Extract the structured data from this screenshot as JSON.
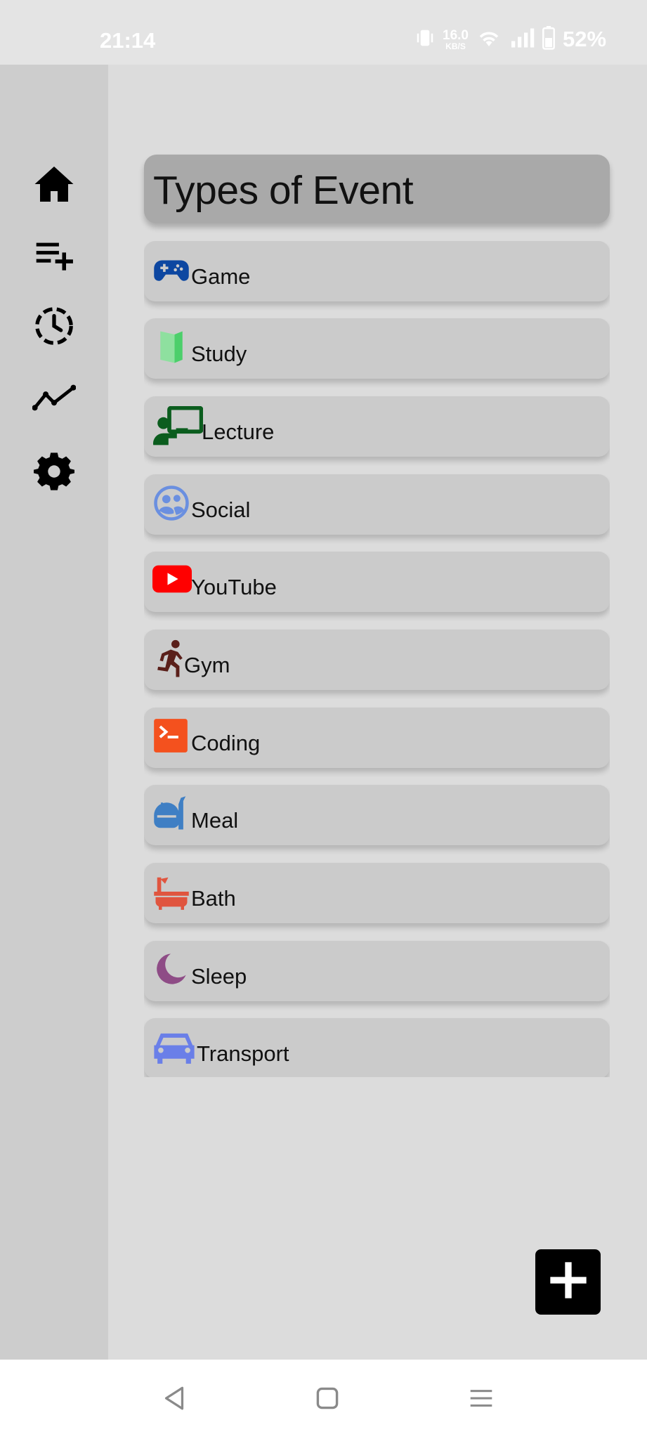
{
  "status_bar": {
    "time": "21:14",
    "speed_value": "16.0",
    "speed_unit": "KB/S",
    "battery": "52%"
  },
  "rail": {
    "items": [
      {
        "icon": "home-icon"
      },
      {
        "icon": "playlist-add-icon"
      },
      {
        "icon": "history-icon"
      },
      {
        "icon": "trending-icon"
      },
      {
        "icon": "settings-icon"
      }
    ]
  },
  "header": {
    "title": "Types of Event"
  },
  "events": [
    {
      "label": "Game",
      "icon": "gamepad-icon",
      "color": "#0d47a1"
    },
    {
      "label": "Study",
      "icon": "book-icon",
      "color": "#5fd67a"
    },
    {
      "label": "Lecture",
      "icon": "presentation-icon",
      "color": "#0b5d1e"
    },
    {
      "label": "Social",
      "icon": "group-icon",
      "color": "#6a8fe0"
    },
    {
      "label": "YouTube",
      "icon": "youtube-icon",
      "color": "#ff0000"
    },
    {
      "label": "Gym",
      "icon": "running-icon",
      "color": "#5a1f1a"
    },
    {
      "label": "Coding",
      "icon": "terminal-icon",
      "color": "#f4511e"
    },
    {
      "label": "Meal",
      "icon": "meal-icon",
      "color": "#3f7fc4"
    },
    {
      "label": "Bath",
      "icon": "bathtub-icon",
      "color": "#e0553f"
    },
    {
      "label": "Sleep",
      "icon": "moon-icon",
      "color": "#8e4c86"
    },
    {
      "label": "Transport",
      "icon": "car-icon",
      "color": "#6a7fe8"
    }
  ],
  "fab": {
    "icon": "add-icon"
  },
  "navbar": {
    "items": [
      {
        "icon": "back-icon"
      },
      {
        "icon": "home-square-icon"
      },
      {
        "icon": "menu-icon"
      }
    ]
  }
}
